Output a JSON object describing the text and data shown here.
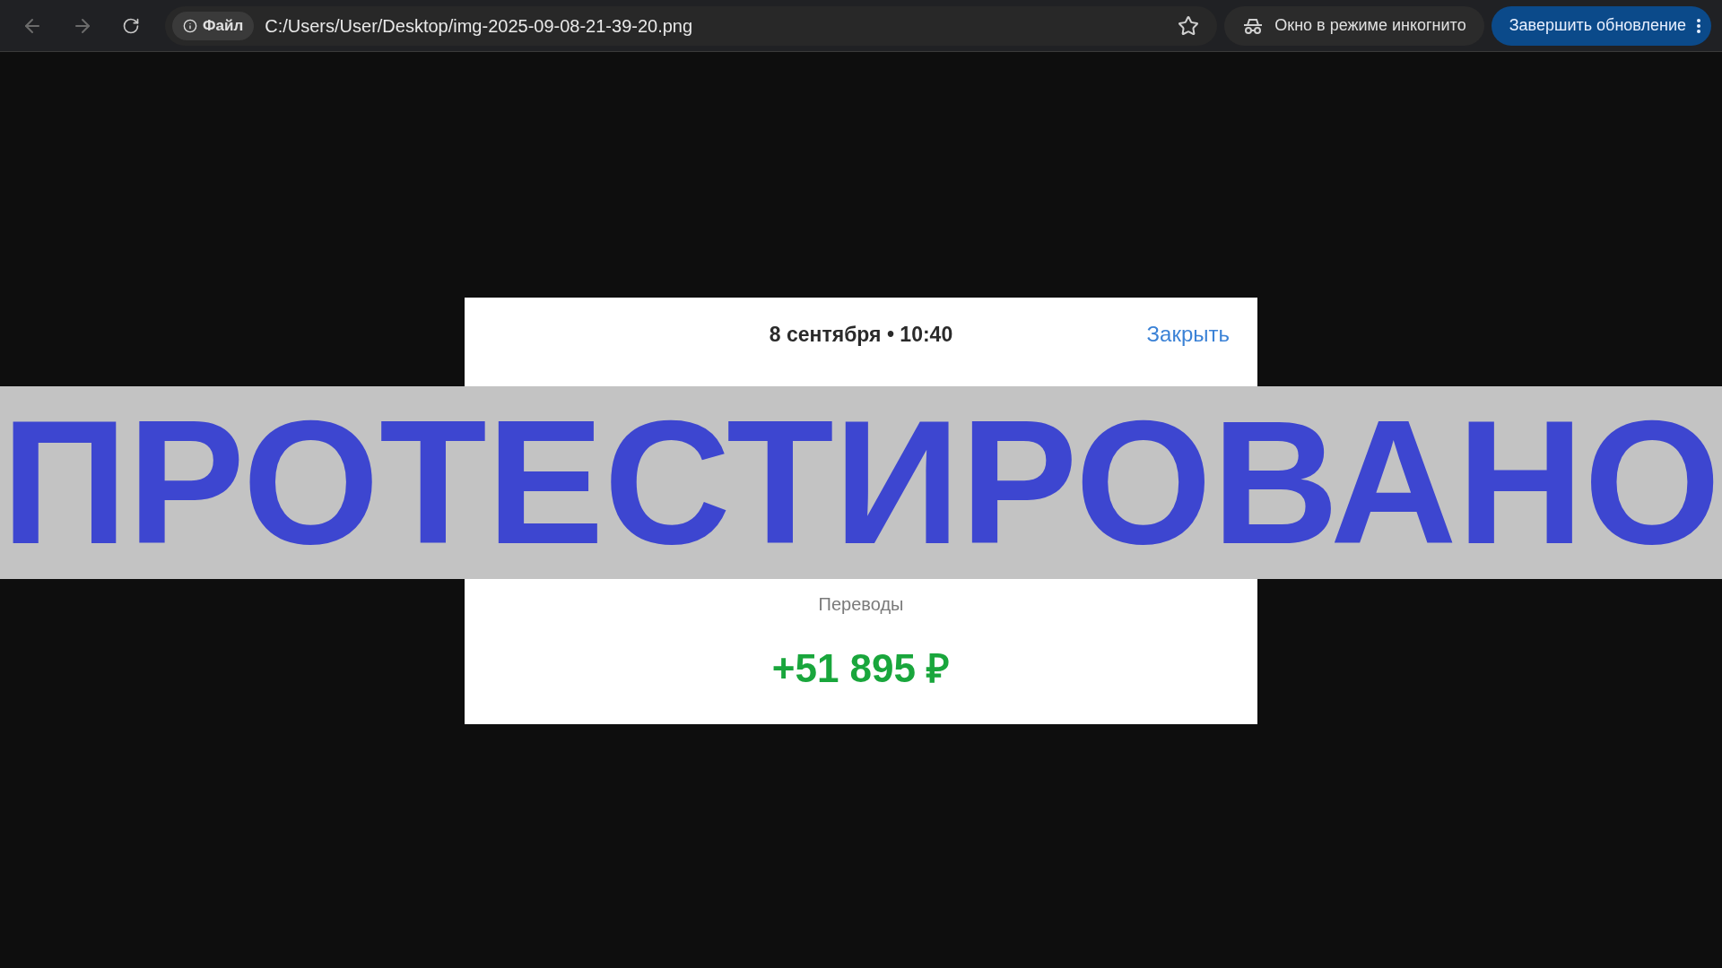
{
  "browser": {
    "security_chip": "Файл",
    "address": "C:/Users/User/Desktop/img-2025-09-08-21-39-20.png",
    "incognito": "Окно в режиме инкогнито",
    "update_button": "Завершить обновление"
  },
  "receipt": {
    "datetime": "8 сентября • 10:40",
    "close": "Закрыть",
    "category": "Переводы",
    "amount": "+51 895 ₽"
  },
  "banner": {
    "text": "ПРОТЕСТИРОВАНО"
  }
}
